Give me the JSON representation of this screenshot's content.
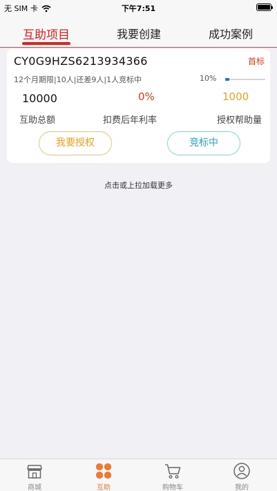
{
  "status_bar": {
    "carrier": "无 SIM 卡",
    "time": "下午7:51"
  },
  "tabs": [
    {
      "label": "互助项目",
      "active": true
    },
    {
      "label": "我要创建",
      "active": false
    },
    {
      "label": "成功案例",
      "active": false
    }
  ],
  "card": {
    "code": "CY0G9HZS6213934366",
    "first_tag": "首标",
    "meta": "12个月期限|10人|还差9人|1人竞标中",
    "progress_text": "10%",
    "progress": 0.1,
    "amount": "10000",
    "rate": "0%",
    "auth_amount": "1000",
    "amount_label": "互助总额",
    "rate_label": "扣费后年利率",
    "auth_label": "授权帮助量",
    "authorize_button": "我要授权",
    "bidding_button": "竞标中"
  },
  "load_more": "点击或上拉加载更多",
  "bottom_nav": [
    {
      "label": "商城",
      "icon": "shop-icon",
      "active": false
    },
    {
      "label": "互助",
      "icon": "clover-icon",
      "active": true
    },
    {
      "label": "购物车",
      "icon": "cart-icon",
      "active": false
    },
    {
      "label": "我的",
      "icon": "user-icon",
      "active": false
    }
  ],
  "colors": {
    "accent": "#e02020",
    "orange": "#f07830",
    "gold": "#f0a020",
    "teal": "#2aa3c9",
    "background": "#f1f0f5"
  }
}
